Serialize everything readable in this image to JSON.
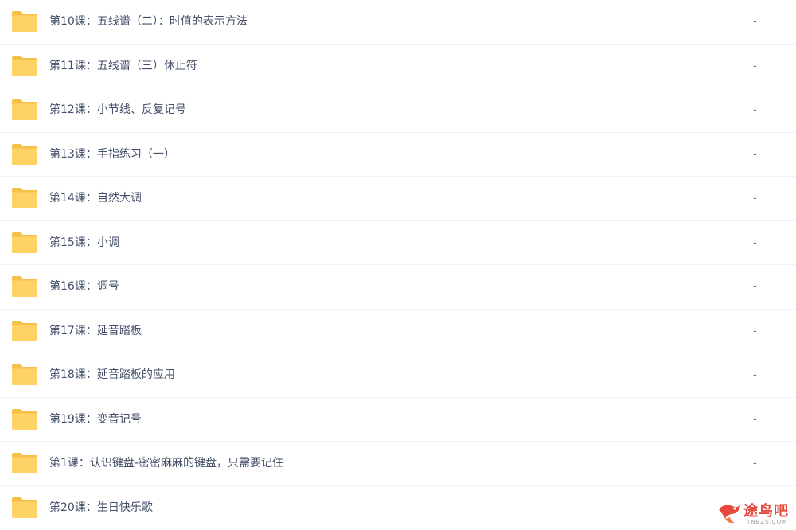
{
  "files": [
    {
      "name": "第10课：五线谱（二）：时值的表示方法",
      "size": "-",
      "icon": "folder-icon"
    },
    {
      "name": "第11课：五线谱（三）休止符",
      "size": "-",
      "icon": "folder-icon"
    },
    {
      "name": "第12课：小节线、反复记号",
      "size": "-",
      "icon": "folder-icon"
    },
    {
      "name": "第13课：手指练习（一）",
      "size": "-",
      "icon": "folder-icon"
    },
    {
      "name": "第14课：自然大调",
      "size": "-",
      "icon": "folder-icon"
    },
    {
      "name": "第15课：小调",
      "size": "-",
      "icon": "folder-icon"
    },
    {
      "name": "第16课：调号",
      "size": "-",
      "icon": "folder-icon"
    },
    {
      "name": "第17课：延音踏板",
      "size": "-",
      "icon": "folder-icon"
    },
    {
      "name": "第18课：延音踏板的应用",
      "size": "-",
      "icon": "folder-icon"
    },
    {
      "name": "第19课：变音记号",
      "size": "-",
      "icon": "folder-icon"
    },
    {
      "name": "第1课：认识键盘-密密麻麻的键盘，只需要记住",
      "size": "-",
      "icon": "folder-icon"
    },
    {
      "name": "第20课：生日快乐歌",
      "size": "-",
      "icon": "folder-icon"
    }
  ],
  "watermark": {
    "text": "途鸟吧",
    "subtext": "TNBZS.COM",
    "icon": "tunaoba-logo-icon"
  },
  "colors": {
    "folder_body": "#ffd266",
    "folder_tab": "#f5c04a",
    "text": "#424e67",
    "watermark": "#e8483b"
  }
}
